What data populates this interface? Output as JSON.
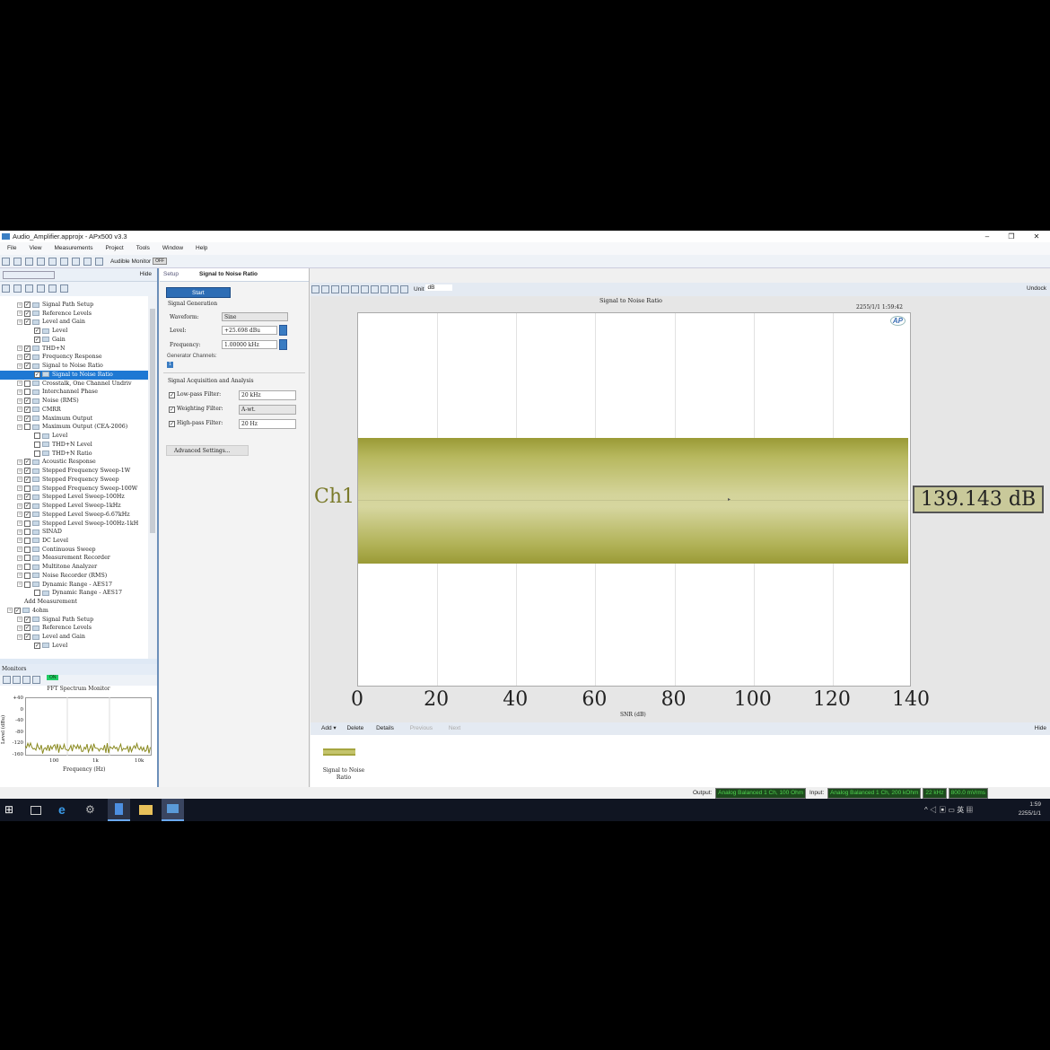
{
  "window": {
    "title": "Audio_Amplifier.approjx - APx500 v3.3",
    "minimize": "–",
    "restore": "❐",
    "close": "✕"
  },
  "menu": [
    "File",
    "View",
    "Measurements",
    "Project",
    "Tools",
    "Window",
    "Help"
  ],
  "toolbar": {
    "audible_monitor": "Audible Monitor",
    "audible_state": "OFF"
  },
  "left_panel": {
    "hide": "Hide",
    "tree": [
      {
        "label": "Signal Path Setup",
        "depth": 1,
        "checked": true
      },
      {
        "label": "Reference Levels",
        "depth": 1,
        "checked": true
      },
      {
        "label": "Level and Gain",
        "depth": 1,
        "checked": true
      },
      {
        "label": "Level",
        "depth": 2,
        "checked": true
      },
      {
        "label": "Gain",
        "depth": 2,
        "checked": true
      },
      {
        "label": "THD+N",
        "depth": 1,
        "checked": true
      },
      {
        "label": "Frequency Response",
        "depth": 1,
        "checked": true
      },
      {
        "label": "Signal to Noise Ratio",
        "depth": 1,
        "checked": true
      },
      {
        "label": "Signal to Noise Ratio",
        "depth": 2,
        "checked": true,
        "selected": true
      },
      {
        "label": "Crosstalk, One Channel Undriv",
        "depth": 1,
        "checked": false
      },
      {
        "label": "Interchannel Phase",
        "depth": 1,
        "checked": false
      },
      {
        "label": "Noise (RMS)",
        "depth": 1,
        "checked": true
      },
      {
        "label": "CMRR",
        "depth": 1,
        "checked": true
      },
      {
        "label": "Maximum Output",
        "depth": 1,
        "checked": true
      },
      {
        "label": "Maximum Output (CEA-2006)",
        "depth": 1,
        "checked": false
      },
      {
        "label": "Level",
        "depth": 2,
        "checked": false
      },
      {
        "label": "THD+N Level",
        "depth": 2,
        "checked": false
      },
      {
        "label": "THD+N Ratio",
        "depth": 2,
        "checked": false
      },
      {
        "label": "Acoustic Response",
        "depth": 1,
        "checked": true
      },
      {
        "label": "Stepped Frequency Sweep-1W",
        "depth": 1,
        "checked": true
      },
      {
        "label": "Stepped Frequency Sweep",
        "depth": 1,
        "checked": true
      },
      {
        "label": "Stepped Frequency Sweep-100W",
        "depth": 1,
        "checked": false
      },
      {
        "label": "Stepped Level Sweep-100Hz",
        "depth": 1,
        "checked": true
      },
      {
        "label": "Stepped Level Sweep-1kHz",
        "depth": 1,
        "checked": true
      },
      {
        "label": "Stepped Level Sweep-6.67kHz",
        "depth": 1,
        "checked": true
      },
      {
        "label": "Stepped Level Sweep-100Hz-1kH",
        "depth": 1,
        "checked": false
      },
      {
        "label": "SINAD",
        "depth": 1,
        "checked": false
      },
      {
        "label": "DC Level",
        "depth": 1,
        "checked": false
      },
      {
        "label": "Continuous Sweep",
        "depth": 1,
        "checked": false
      },
      {
        "label": "Measurement Recorder",
        "depth": 1,
        "checked": false
      },
      {
        "label": "Multitone Analyzer",
        "depth": 1,
        "checked": false
      },
      {
        "label": "Noise Recorder (RMS)",
        "depth": 1,
        "checked": false
      },
      {
        "label": "Dynamic Range - AES17",
        "depth": 1,
        "checked": false
      },
      {
        "label": "Dynamic Range - AES17",
        "depth": 2,
        "checked": false
      },
      {
        "label": "Add Measurement",
        "depth": 1,
        "nocheck": true
      },
      {
        "label": "4ohm",
        "depth": 0,
        "checked": true
      },
      {
        "label": "Signal Path Setup",
        "depth": 1,
        "checked": true
      },
      {
        "label": "Reference Levels",
        "depth": 1,
        "checked": true
      },
      {
        "label": "Level and Gain",
        "depth": 1,
        "checked": true
      },
      {
        "label": "Level",
        "depth": 2,
        "checked": true
      }
    ]
  },
  "monitors": {
    "title": "Monitors",
    "on": "ON",
    "chart_title": "FFT Spectrum Monitor",
    "ylabel": "Level (dBu)",
    "xlabel": "Frequency (Hz)",
    "yticks": [
      "+40",
      "0",
      "-40",
      "-80",
      "-120",
      "-160"
    ],
    "xticks": [
      "100",
      "1k",
      "10k"
    ]
  },
  "setup": {
    "tab": "Setup",
    "title": "Signal to Noise Ratio",
    "start": "Start",
    "gen_header": "Signal Generation",
    "waveform_label": "Waveform:",
    "waveform": "Sine",
    "level_label": "Level:",
    "level": "+25.698 dBu",
    "freq_label": "Frequency:",
    "freq": "1.00000 kHz",
    "gen_channels": "Generator Channels:",
    "gen_channel_1": "1",
    "acq_header": "Signal Acquisition and Analysis",
    "lpf_label": "Low-pass Filter:",
    "lpf": "20 kHz",
    "wf_label": "Weighting Filter:",
    "wf": "A-wt.",
    "hpf_label": "High-pass Filter:",
    "hpf": "20 Hz",
    "advanced": "Advanced Settings..."
  },
  "graph_toolbar": {
    "unit_label": "Unit",
    "unit": "dB",
    "undock": "Undock"
  },
  "chart_data": {
    "type": "bar",
    "orientation": "horizontal",
    "title": "Signal to Noise Ratio",
    "timestamp": "2255/1/1 1:59:42",
    "categories": [
      "Ch1"
    ],
    "values": [
      139.143
    ],
    "value_label": "139.143 dB",
    "xlabel": "SNR (dB)",
    "xlim": [
      0,
      140
    ],
    "xticks": [
      "0",
      "20",
      "40",
      "60",
      "80",
      "100",
      "120",
      "140"
    ],
    "logo": "AP"
  },
  "results_toolbar": {
    "add": "Add",
    "delete": "Delete",
    "details": "Details",
    "previous": "Previous",
    "next": "Next",
    "hide": "Hide"
  },
  "thumbnail": {
    "label": "Signal to Noise Ratio"
  },
  "status": {
    "output_label": "Output:",
    "output": "Analog Balanced 1 Ch, 100 Ohm",
    "input_label": "Input:",
    "input": "Analog Balanced 1 Ch, 200 kOhm",
    "bandwidth": "22 kHz",
    "level": "800.0 mVrms"
  },
  "taskbar": {
    "time": "1:59",
    "date": "2255/1/1",
    "ime": "英"
  }
}
